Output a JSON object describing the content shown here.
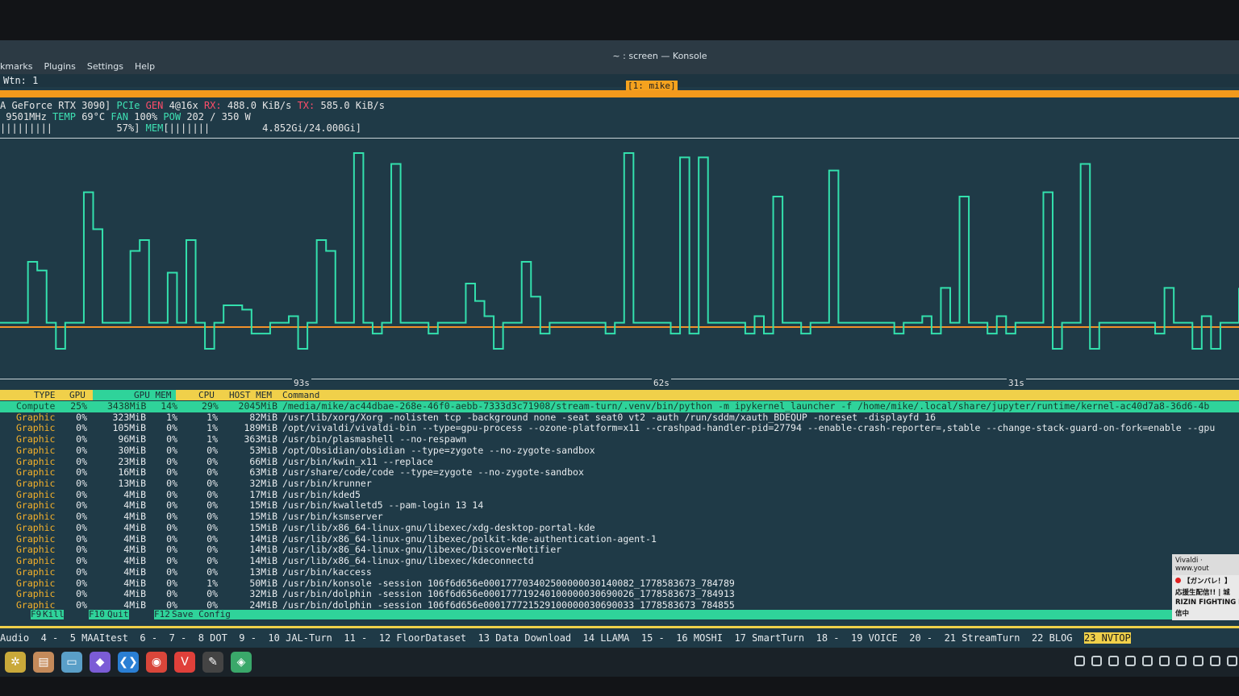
{
  "window": {
    "title": "~ : screen — Konsole",
    "menu": [
      "kmarks",
      "Plugins",
      "Settings",
      "Help"
    ]
  },
  "screen": {
    "wtn": "Wtn: 1",
    "window_label": "[1: mike]"
  },
  "gpu": {
    "line1": "A GeForce RTX 3090]",
    "pcie": "PCIe",
    "gen": "GEN",
    "link": "4@16x",
    "rx_label": "RX:",
    "rx": "488.0 KiB/s",
    "tx_label": "TX:",
    "tx": "585.0 KiB/s",
    "clock": "9501MHz",
    "temp_label": "TEMP",
    "temp": "69°C",
    "fan_label": "FAN",
    "fan": "100%",
    "pow_label": "POW",
    "pow": "202 / 350 W",
    "util_bar": "|||||||||",
    "util": "57%]",
    "mem_label": "MEM",
    "mem_bar": "[|||||||",
    "mem": "4.852Gi/24.000Gi]"
  },
  "graph": {
    "ticks": [
      "93s",
      "62s",
      "31s"
    ],
    "gpu_series": [
      2,
      2,
      2,
      30,
      26,
      2,
      -10,
      2,
      2,
      62,
      45,
      2,
      2,
      2,
      35,
      40,
      2,
      2,
      25,
      2,
      40,
      2,
      -10,
      2,
      10,
      10,
      8,
      -3,
      -3,
      2,
      2,
      5,
      -10,
      2,
      40,
      35,
      2,
      2,
      80,
      2,
      -3,
      2,
      75,
      2,
      2,
      2,
      -3,
      2,
      2,
      2,
      20,
      12,
      5,
      -10,
      2,
      2,
      30,
      14,
      -3,
      2,
      2,
      2,
      2,
      2,
      2,
      -3,
      2,
      80,
      2,
      2,
      2,
      2,
      -3,
      78,
      -3,
      78,
      2,
      2,
      2,
      2,
      -3,
      5,
      -3,
      60,
      2,
      2,
      -3,
      2,
      2,
      72,
      2,
      2,
      2,
      2,
      2,
      2,
      -3,
      2,
      2,
      5,
      -3,
      18,
      2,
      60,
      2,
      2,
      -3,
      5,
      -3,
      2,
      2,
      2,
      62,
      -10,
      2,
      2,
      75,
      -10,
      2,
      2,
      2,
      2,
      2,
      2,
      -3,
      18,
      2,
      2,
      -10,
      5,
      -10,
      2,
      2,
      18
    ],
    "colors": {
      "gpu": "#33e0ad",
      "mem": "#f2912a",
      "baseline": "#f2912a"
    }
  },
  "table": {
    "headers": [
      "TYPE",
      "GPU",
      "GPU MEM",
      "CPU",
      "HOST MEM",
      "Command"
    ],
    "rows": [
      {
        "type": "Compute",
        "gpu": "25%",
        "gpumem": "3438MiB",
        "gpumem_pct": "14%",
        "cpu": "29%",
        "hostmem": "2045MiB",
        "cmd": "/media/mike/ac44dbae-268e-46f0-aebb-7333d3c71908/stream-turn/.venv/bin/python -m ipykernel_launcher -f /home/mike/.local/share/jupyter/runtime/kernel-ac40d7a8-36d6-4b"
      },
      {
        "type": "Graphic",
        "gpu": "0%",
        "gpumem": "323MiB",
        "gpumem_pct": "1%",
        "cpu": "1%",
        "hostmem": "82MiB",
        "cmd": "/usr/lib/xorg/Xorg -nolisten tcp -background none -seat seat0 vt2 -auth /run/sddm/xauth_BDEQUP -noreset -displayfd 16"
      },
      {
        "type": "Graphic",
        "gpu": "0%",
        "gpumem": "105MiB",
        "gpumem_pct": "0%",
        "cpu": "1%",
        "hostmem": "189MiB",
        "cmd": "/opt/vivaldi/vivaldi-bin --type=gpu-process --ozone-platform=x11 --crashpad-handler-pid=27794 --enable-crash-reporter=,stable --change-stack-guard-on-fork=enable --gpu"
      },
      {
        "type": "Graphic",
        "gpu": "0%",
        "gpumem": "96MiB",
        "gpumem_pct": "0%",
        "cpu": "1%",
        "hostmem": "363MiB",
        "cmd": "/usr/bin/plasmashell --no-respawn"
      },
      {
        "type": "Graphic",
        "gpu": "0%",
        "gpumem": "30MiB",
        "gpumem_pct": "0%",
        "cpu": "0%",
        "hostmem": "53MiB",
        "cmd": "/opt/Obsidian/obsidian --type=zygote --no-zygote-sandbox"
      },
      {
        "type": "Graphic",
        "gpu": "0%",
        "gpumem": "23MiB",
        "gpumem_pct": "0%",
        "cpu": "0%",
        "hostmem": "66MiB",
        "cmd": "/usr/bin/kwin_x11 --replace"
      },
      {
        "type": "Graphic",
        "gpu": "0%",
        "gpumem": "16MiB",
        "gpumem_pct": "0%",
        "cpu": "0%",
        "hostmem": "63MiB",
        "cmd": "/usr/share/code/code --type=zygote --no-zygote-sandbox"
      },
      {
        "type": "Graphic",
        "gpu": "0%",
        "gpumem": "13MiB",
        "gpumem_pct": "0%",
        "cpu": "0%",
        "hostmem": "32MiB",
        "cmd": "/usr/bin/krunner"
      },
      {
        "type": "Graphic",
        "gpu": "0%",
        "gpumem": "4MiB",
        "gpumem_pct": "0%",
        "cpu": "0%",
        "hostmem": "17MiB",
        "cmd": "/usr/bin/kded5"
      },
      {
        "type": "Graphic",
        "gpu": "0%",
        "gpumem": "4MiB",
        "gpumem_pct": "0%",
        "cpu": "0%",
        "hostmem": "15MiB",
        "cmd": "/usr/bin/kwalletd5 --pam-login 13 14"
      },
      {
        "type": "Graphic",
        "gpu": "0%",
        "gpumem": "4MiB",
        "gpumem_pct": "0%",
        "cpu": "0%",
        "hostmem": "15MiB",
        "cmd": "/usr/bin/ksmserver"
      },
      {
        "type": "Graphic",
        "gpu": "0%",
        "gpumem": "4MiB",
        "gpumem_pct": "0%",
        "cpu": "0%",
        "hostmem": "15MiB",
        "cmd": "/usr/lib/x86_64-linux-gnu/libexec/xdg-desktop-portal-kde"
      },
      {
        "type": "Graphic",
        "gpu": "0%",
        "gpumem": "4MiB",
        "gpumem_pct": "0%",
        "cpu": "0%",
        "hostmem": "14MiB",
        "cmd": "/usr/lib/x86_64-linux-gnu/libexec/polkit-kde-authentication-agent-1"
      },
      {
        "type": "Graphic",
        "gpu": "0%",
        "gpumem": "4MiB",
        "gpumem_pct": "0%",
        "cpu": "0%",
        "hostmem": "14MiB",
        "cmd": "/usr/lib/x86_64-linux-gnu/libexec/DiscoverNotifier"
      },
      {
        "type": "Graphic",
        "gpu": "0%",
        "gpumem": "4MiB",
        "gpumem_pct": "0%",
        "cpu": "0%",
        "hostmem": "14MiB",
        "cmd": "/usr/lib/x86_64-linux-gnu/libexec/kdeconnectd"
      },
      {
        "type": "Graphic",
        "gpu": "0%",
        "gpumem": "4MiB",
        "gpumem_pct": "0%",
        "cpu": "0%",
        "hostmem": "13MiB",
        "cmd": "/usr/bin/kaccess"
      },
      {
        "type": "Graphic",
        "gpu": "0%",
        "gpumem": "4MiB",
        "gpumem_pct": "0%",
        "cpu": "1%",
        "hostmem": "50MiB",
        "cmd": "/usr/bin/konsole -session 106f6d656e000177703402500000030140082_1778583673_784789"
      },
      {
        "type": "Graphic",
        "gpu": "0%",
        "gpumem": "4MiB",
        "gpumem_pct": "0%",
        "cpu": "0%",
        "hostmem": "32MiB",
        "cmd": "/usr/bin/dolphin -session 106f6d656e000177719240100000030690026_1778583673_784913"
      },
      {
        "type": "Graphic",
        "gpu": "0%",
        "gpumem": "4MiB",
        "gpumem_pct": "0%",
        "cpu": "0%",
        "hostmem": "24MiB",
        "cmd": "/usr/bin/dolphin -session 106f6d656e000177721529100000030690033_1778583673_784855"
      }
    ]
  },
  "fnkeys": [
    {
      "key": "F9",
      "label": "Kill"
    },
    {
      "key": "F10",
      "label": "Quit"
    },
    {
      "key": "F12",
      "label": "Save Config"
    }
  ],
  "tabs": {
    "items": [
      "Audio",
      "4 -",
      "5 MAAItest",
      "6 -",
      "7 -",
      "8 DOT",
      "9 -",
      "10 JAL-Turn",
      "11 -",
      "12 FloorDataset",
      "13 Data Download",
      "14 LLAMA",
      "15 -",
      "16 MOSHI",
      "17 SmartTurn",
      "18 -",
      "19 VOICE",
      "20 -",
      "21 StreamTurn",
      "22 BLOG"
    ],
    "active": "23 NVTOP"
  },
  "notification": {
    "source": "Vivaldi · www.yout",
    "line1": "【ガンバレ！】",
    "line2": "応援生配信!! | 城",
    "line3": "RIZIN FIGHTING FE",
    "line4": "信中"
  },
  "taskbar": {
    "apps": [
      {
        "name": "app-launcher-icon",
        "glyph": "✲",
        "color": "#c9a93a"
      },
      {
        "name": "file-manager-icon",
        "glyph": "▤",
        "color": "#c48a5a"
      },
      {
        "name": "dolphin-icon",
        "glyph": "▭",
        "color": "#5a9fc8"
      },
      {
        "name": "obsidian-icon",
        "glyph": "◆",
        "color": "#7b5cd6"
      },
      {
        "name": "vscode-icon",
        "glyph": "❮❯",
        "color": "#2a7fd4"
      },
      {
        "name": "chrome-icon",
        "glyph": "◉",
        "color": "#d9463a"
      },
      {
        "name": "vivaldi-icon",
        "glyph": "V",
        "color": "#e0403a"
      },
      {
        "name": "text-editor-icon",
        "glyph": "✎",
        "color": "#444"
      },
      {
        "name": "layers-icon",
        "glyph": "◈",
        "color": "#3aa86a"
      }
    ]
  }
}
